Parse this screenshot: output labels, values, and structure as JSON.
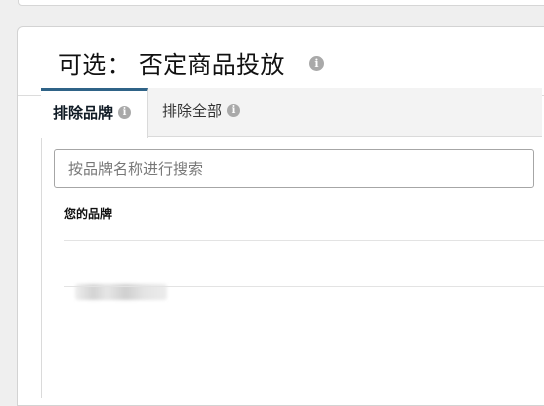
{
  "panel": {
    "title": "可选： 否定商品投放",
    "title_info_icon": "info-icon"
  },
  "tabs": [
    {
      "label": "排除品牌",
      "active": true,
      "icon": "info-icon"
    },
    {
      "label": "排除全部",
      "active": false,
      "icon": "info-icon"
    }
  ],
  "search": {
    "placeholder": "按品牌名称进行搜索",
    "value": ""
  },
  "brand_list": {
    "header": "您的品牌",
    "items": [
      {
        "label": "",
        "obscured": true
      }
    ]
  },
  "colors": {
    "active_tab_accent": "#2f6387",
    "info_icon": "#a9a9a9",
    "background": "#efefef"
  }
}
